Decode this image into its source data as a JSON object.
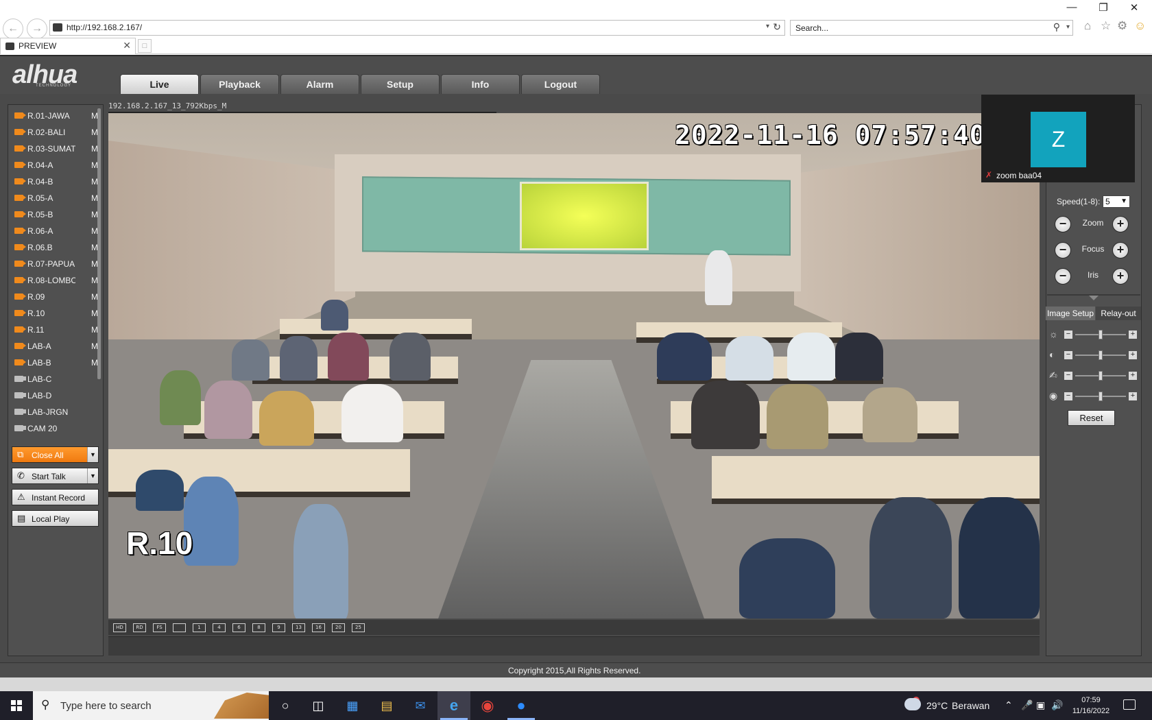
{
  "browser": {
    "url": "http://192.168.2.167/",
    "search_placeholder": "Search...",
    "tab_title": "PREVIEW"
  },
  "app": {
    "logo": "alhua",
    "logo_sub": "TECHNOLOGY",
    "tabs": [
      {
        "label": "Live"
      },
      {
        "label": "Playback"
      },
      {
        "label": "Alarm"
      },
      {
        "label": "Setup"
      },
      {
        "label": "Info"
      },
      {
        "label": "Logout"
      }
    ],
    "active_tab": "Live"
  },
  "cameras": [
    {
      "name": "R.01-JAWA",
      "flag": "M",
      "active": true
    },
    {
      "name": "R.02-BALI",
      "flag": "M",
      "active": true
    },
    {
      "name": "R.03-SUMAT",
      "flag": "M",
      "active": true
    },
    {
      "name": "R.04-A",
      "flag": "M",
      "active": true
    },
    {
      "name": "R.04-B",
      "flag": "M",
      "active": true
    },
    {
      "name": "R.05-A",
      "flag": "M",
      "active": true
    },
    {
      "name": "R.05-B",
      "flag": "M",
      "active": true
    },
    {
      "name": "R.06-A",
      "flag": "M",
      "active": true
    },
    {
      "name": "R.06.B",
      "flag": "M",
      "active": true
    },
    {
      "name": "R.07-PAPUA",
      "flag": "M",
      "active": true
    },
    {
      "name": "R.08-LOMBO",
      "flag": "M",
      "active": true
    },
    {
      "name": "R.09",
      "flag": "M",
      "active": true
    },
    {
      "name": "R.10",
      "flag": "M",
      "active": true
    },
    {
      "name": "R.11",
      "flag": "M",
      "active": true
    },
    {
      "name": "LAB-A",
      "flag": "M",
      "active": true
    },
    {
      "name": "LAB-B",
      "flag": "M",
      "active": true
    },
    {
      "name": "LAB-C",
      "flag": "",
      "active": false
    },
    {
      "name": "LAB-D",
      "flag": "",
      "active": false
    },
    {
      "name": "LAB-JRGN",
      "flag": "",
      "active": false
    },
    {
      "name": "CAM 20",
      "flag": "",
      "active": false
    }
  ],
  "side_buttons": {
    "close_all": "Close All",
    "start_talk": "Start Talk",
    "instant_record": "Instant Record",
    "local_play": "Local Play"
  },
  "video": {
    "stream_label": "192.168.2.167_13_792Kbps_M",
    "timestamp": "2022-11-16 07:57:40",
    "room_label": "R.10"
  },
  "layout_icons": [
    "HD",
    "RD",
    "FS",
    "",
    "1",
    "4",
    "6",
    "8",
    "9",
    "13",
    "16",
    "20",
    "25"
  ],
  "ptz": {
    "speed_label": "Speed(1-8):",
    "speed_value": "5",
    "zoom": "Zoom",
    "focus": "Focus",
    "iris": "Iris"
  },
  "image_setup": {
    "tab_image": "Image Setup",
    "tab_relay": "Relay-out",
    "sliders": [
      {
        "name": "brightness",
        "value": 0.5
      },
      {
        "name": "contrast",
        "value": 0.5
      },
      {
        "name": "saturation",
        "value": 0.5
      },
      {
        "name": "hue",
        "value": 0.5
      }
    ],
    "reset": "Reset"
  },
  "zoom_overlay": {
    "initial": "Z",
    "name": "zoom baa04"
  },
  "footer": {
    "copyright": "Copyright 2015,All Rights Reserved."
  },
  "taskbar": {
    "search_placeholder": "Type here to search",
    "weather_temp": "29°C",
    "weather_desc": "Berawan",
    "time": "07:59",
    "date": "11/16/2022"
  }
}
